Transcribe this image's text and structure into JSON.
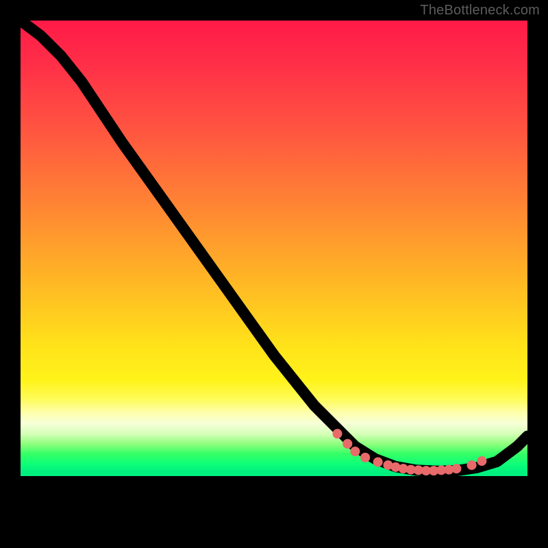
{
  "watermark": "TheBottleneck.com",
  "chart_data": {
    "type": "line",
    "title": "",
    "xlabel": "",
    "ylabel": "",
    "xlim": [
      0,
      100
    ],
    "ylim": [
      0,
      100
    ],
    "grid": false,
    "legend": false,
    "series": [
      {
        "name": "bottleneck-curve",
        "x": [
          0,
          4,
          8,
          12,
          20,
          30,
          40,
          50,
          58,
          62,
          66,
          70,
          74,
          78,
          82,
          86,
          90,
          94,
          98,
          100
        ],
        "y": [
          100,
          97,
          93,
          88,
          76,
          62,
          48,
          34,
          24,
          20,
          16,
          13.5,
          12,
          11.3,
          11.1,
          11.2,
          11.8,
          13,
          16,
          18
        ]
      }
    ],
    "highlight_points": {
      "name": "near-optimal-dots",
      "x": [
        62.5,
        64.5,
        66,
        68,
        70.5,
        72.5,
        74,
        75.5,
        77,
        78.5,
        80,
        81.5,
        83,
        84.5,
        86,
        89,
        91
      ],
      "y": [
        18.5,
        16.5,
        15,
        13.8,
        12.9,
        12.3,
        11.9,
        11.6,
        11.4,
        11.3,
        11.2,
        11.2,
        11.3,
        11.4,
        11.6,
        12.3,
        13.1
      ]
    },
    "background": {
      "type": "vertical-gradient",
      "stops": [
        {
          "pos": 0.0,
          "color": "#ff1a47"
        },
        {
          "pos": 0.5,
          "color": "#ffb924"
        },
        {
          "pos": 0.72,
          "color": "#fff31a"
        },
        {
          "pos": 0.8,
          "color": "#f6ffd7"
        },
        {
          "pos": 0.87,
          "color": "#0dff77"
        },
        {
          "pos": 0.9,
          "color": "#000000"
        }
      ]
    }
  }
}
